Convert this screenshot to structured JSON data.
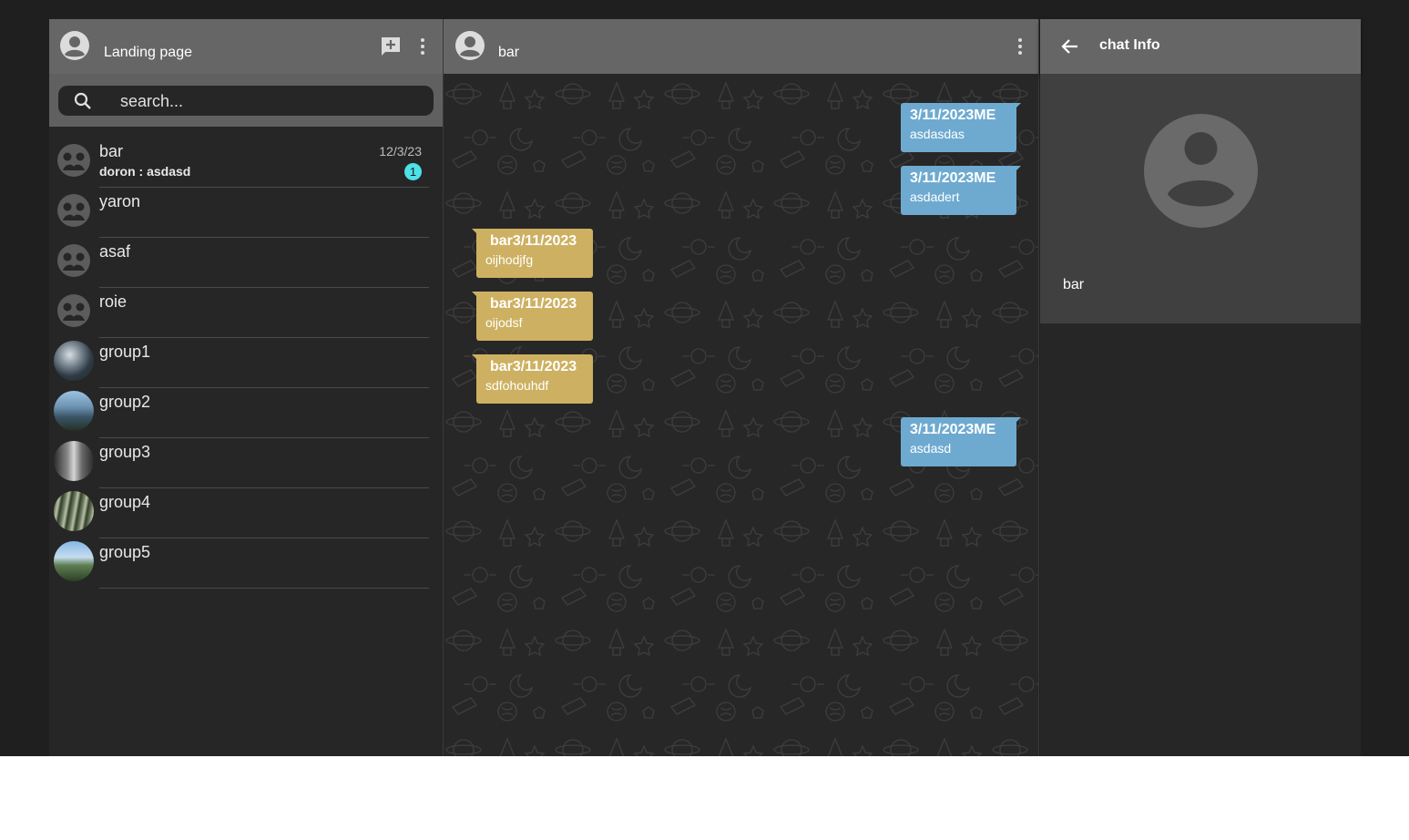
{
  "left_panel": {
    "title": "Landing page",
    "search": {
      "placeholder": "search..."
    },
    "chats": [
      {
        "name": "bar",
        "preview": "doron : asdasd",
        "date": "12/3/23",
        "unread": "1",
        "avatar": "default-avatar-icon"
      },
      {
        "name": "yaron",
        "preview": "",
        "date": "",
        "unread": "",
        "avatar": "default-avatar-icon"
      },
      {
        "name": "asaf",
        "preview": "",
        "date": "",
        "unread": "",
        "avatar": "default-avatar-icon"
      },
      {
        "name": "roie",
        "preview": "",
        "date": "",
        "unread": "",
        "avatar": "default-avatar-icon"
      },
      {
        "name": "group1",
        "preview": "",
        "date": "",
        "unread": "",
        "avatar": "photo"
      },
      {
        "name": "group2",
        "preview": "",
        "date": "",
        "unread": "",
        "avatar": "photo"
      },
      {
        "name": "group3",
        "preview": "",
        "date": "",
        "unread": "",
        "avatar": "photo"
      },
      {
        "name": "group4",
        "preview": "",
        "date": "",
        "unread": "",
        "avatar": "photo"
      },
      {
        "name": "group5",
        "preview": "",
        "date": "",
        "unread": "",
        "avatar": "photo"
      }
    ]
  },
  "conversation": {
    "title": "bar",
    "messages": [
      {
        "from": "me",
        "meta": "3/11/2023ME",
        "text": "asdasdas"
      },
      {
        "from": "me",
        "meta": "3/11/2023ME",
        "text": "asdadert"
      },
      {
        "from": "other",
        "meta": "bar3/11/2023",
        "text": "oijhodjfg"
      },
      {
        "from": "other",
        "meta": "bar3/11/2023",
        "text": "oijodsf"
      },
      {
        "from": "other",
        "meta": "bar3/11/2023",
        "text": "sdfohouhdf"
      },
      {
        "from": "me",
        "meta": "3/11/2023ME",
        "text": "asdasd"
      }
    ]
  },
  "info_panel": {
    "title": "chat Info",
    "name": "bar"
  },
  "colors": {
    "header": "#666666",
    "panel": "#262626",
    "my_bubble": "#6eaad0",
    "other_bubble": "#cdb061",
    "unread_badge": "#4de1e8"
  }
}
